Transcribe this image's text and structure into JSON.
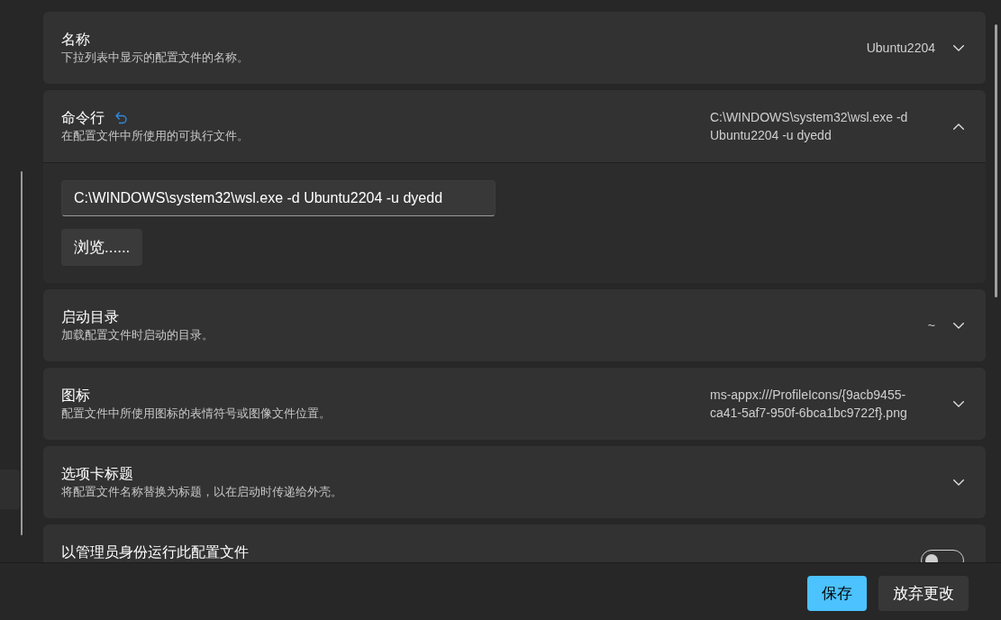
{
  "settings": [
    {
      "kind": "expander",
      "title": "名称",
      "description": "下拉列表中显示的配置文件的名称。",
      "value": "Ubuntu2204",
      "modified": false,
      "expanded": false
    },
    {
      "kind": "expander",
      "title": "命令行",
      "description": "在配置文件中所使用的可执行文件。",
      "value": "C:\\WINDOWS\\system32\\wsl.exe -d Ubuntu2204 -u dyedd",
      "modified": true,
      "expanded": true,
      "field_value": "C:\\WINDOWS\\system32\\wsl.exe -d Ubuntu2204 -u dyedd",
      "browse_button": "浏览......"
    },
    {
      "kind": "expander",
      "title": "启动目录",
      "description": "加载配置文件时启动的目录。",
      "value": "~",
      "modified": false,
      "expanded": false
    },
    {
      "kind": "expander",
      "title": "图标",
      "description": "配置文件中所使用图标的表情符号或图像文件位置。",
      "value": "ms-appx:///ProfileIcons/{9acb9455-ca41-5af7-950f-6bca1bc9722f}.png",
      "modified": false,
      "expanded": false
    },
    {
      "kind": "expander",
      "title": "选项卡标题",
      "description": "将配置文件名称替换为标题，以在启动时传递给外壳。",
      "modified": false,
      "expanded": false
    },
    {
      "kind": "toggle",
      "title": "以管理员身份运行此配置文件",
      "modified": false,
      "on": false
    }
  ],
  "footer": {
    "buttons": [
      {
        "label": "保存",
        "kind": "primary"
      },
      {
        "label": "放弃更改",
        "kind": "secondary"
      }
    ]
  }
}
